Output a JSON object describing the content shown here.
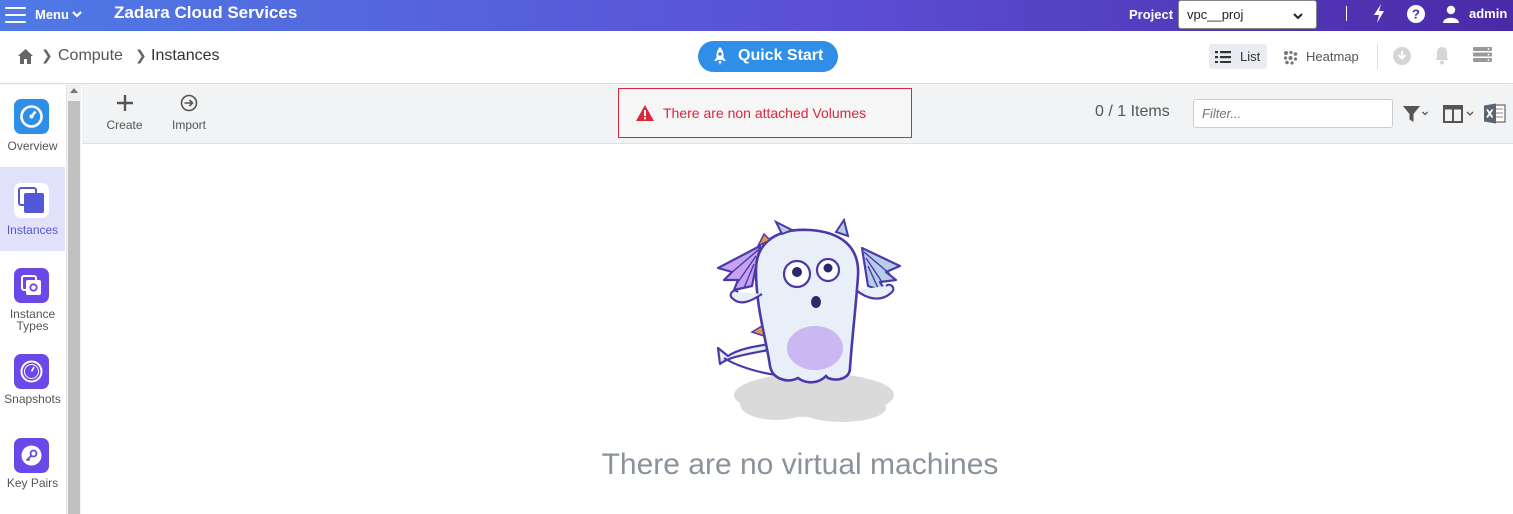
{
  "topbar": {
    "menu_label": "Menu",
    "app_title": "Zadara Cloud Services",
    "project_label": "Project",
    "project_value": "vpc__proj",
    "user_name": "admin"
  },
  "breadcrumb": {
    "items": [
      "Compute",
      "Instances"
    ]
  },
  "quick_start_label": "Quick Start",
  "views": {
    "list_label": "List",
    "heatmap_label": "Heatmap"
  },
  "sidebar": {
    "items": [
      {
        "label": "Overview",
        "icon": "gauge-icon"
      },
      {
        "label": "Instances",
        "icon": "instances-icon",
        "active": true
      },
      {
        "label": "Instance Types",
        "label_line1": "Instance",
        "label_line2": "Types",
        "icon": "instance-types-icon"
      },
      {
        "label": "Snapshots",
        "icon": "snapshot-icon"
      },
      {
        "label": "Key Pairs",
        "icon": "key-icon"
      }
    ]
  },
  "toolbar": {
    "create_label": "Create",
    "import_label": "Import",
    "alert_text": "There are non attached Volumes",
    "items_count": "0 / 1 Items",
    "filter_placeholder": "Filter..."
  },
  "empty_state": {
    "message": "There are no virtual machines"
  },
  "colors": {
    "topbar_start": "#4f7ae6",
    "topbar_end": "#4a2aa6",
    "accent": "#2f8ee8",
    "alert": "#d9273c",
    "sidebar_badge": "#6a49e8",
    "sidebar_active_bg": "#e2e1fb"
  }
}
